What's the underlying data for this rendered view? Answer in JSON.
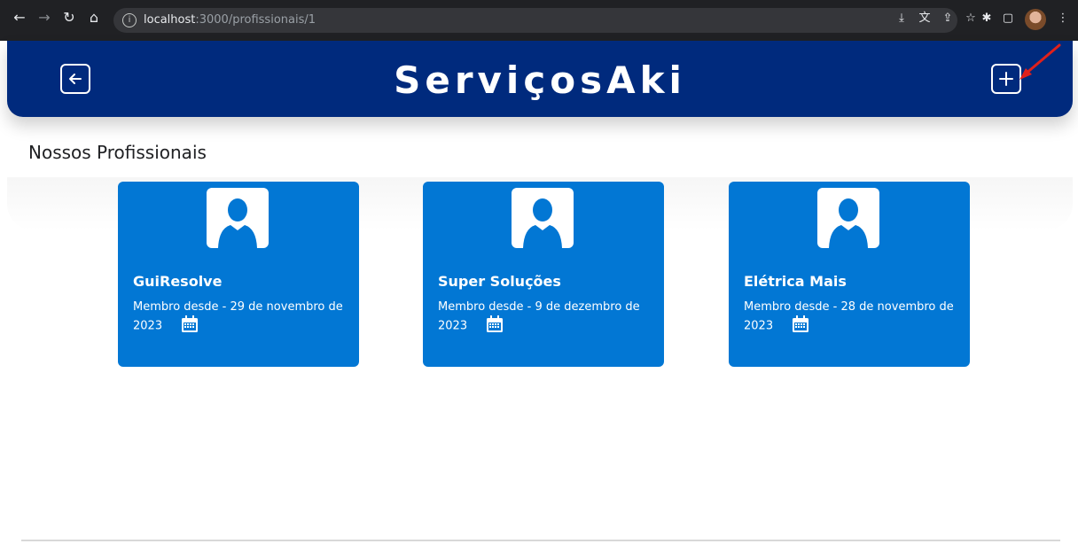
{
  "browser": {
    "url_host": "localhost",
    "url_path": ":3000/profissionais/1",
    "icons": [
      "back-arrow-icon",
      "forward-arrow-icon",
      "reload-icon",
      "home-icon",
      "info-icon",
      "install-icon",
      "translate-icon",
      "share-icon",
      "star-icon",
      "extensions-icon",
      "side-panel-icon",
      "profile-avatar",
      "more-icon"
    ]
  },
  "header": {
    "title": "ServiçosAki",
    "back_icon": "back-arrow-icon",
    "add_icon": "plus-icon",
    "background": "#002a7d"
  },
  "main": {
    "title": "Nossos Profissionais",
    "cards": [
      {
        "name": "GuiResolve",
        "since": "Membro desde - 29 de novembro de 2023"
      },
      {
        "name": "Super Soluções",
        "since": "Membro desde - 9 de dezembro de 2023"
      },
      {
        "name": "Elétrica Mais",
        "since": "Membro desde - 28 de novembro de 2023"
      }
    ],
    "card_color": "#0277d4"
  }
}
